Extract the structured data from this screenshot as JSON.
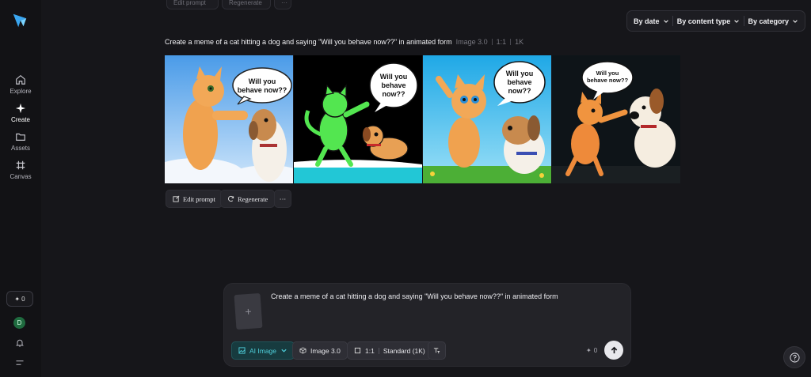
{
  "sidebar": {
    "items": [
      {
        "label": "Explore",
        "icon": "home-icon"
      },
      {
        "label": "Create",
        "icon": "sparkle-icon"
      },
      {
        "label": "Assets",
        "icon": "folder-icon"
      },
      {
        "label": "Canvas",
        "icon": "canvas-icon"
      }
    ],
    "credits": "0",
    "avatar_initial": "D"
  },
  "top_remnant": {
    "edit_prompt": "Edit prompt",
    "regenerate": "Regenerate",
    "more": "···"
  },
  "filters": {
    "by_date": "By date",
    "by_content_type": "By content type",
    "by_category": "By category"
  },
  "generation": {
    "prompt": "Create a meme of a cat hitting a dog and saying \"Will you behave now??\" in animated form",
    "model": "Image 3.0",
    "ratio": "1:1",
    "resolution": "1K",
    "images": [
      {
        "bubble_lines": [
          "Will you",
          "behave now??"
        ]
      },
      {
        "bubble_lines": [
          "Will you",
          "behave",
          "now??"
        ]
      },
      {
        "bubble_lines": [
          "Will you",
          "behave",
          "now??"
        ]
      },
      {
        "bubble_lines": [
          "Will you",
          "behave now??"
        ]
      }
    ]
  },
  "actions": {
    "edit_prompt": "Edit prompt",
    "regenerate": "Regenerate",
    "more": "···"
  },
  "composer": {
    "text": "Create a meme of a cat hitting a dog and saying \"Will you behave now??\" in animated form",
    "add_glyph": "+",
    "tools": {
      "ai_image": "AI Image",
      "model": "Image 3.0",
      "ratio": "1:1",
      "quality": "Standard (1K)"
    },
    "cost": "0",
    "cost_glyph": "✦"
  },
  "colors": {
    "background": "#16161a",
    "accent": "#4fd0dc",
    "panel": "#232328"
  }
}
